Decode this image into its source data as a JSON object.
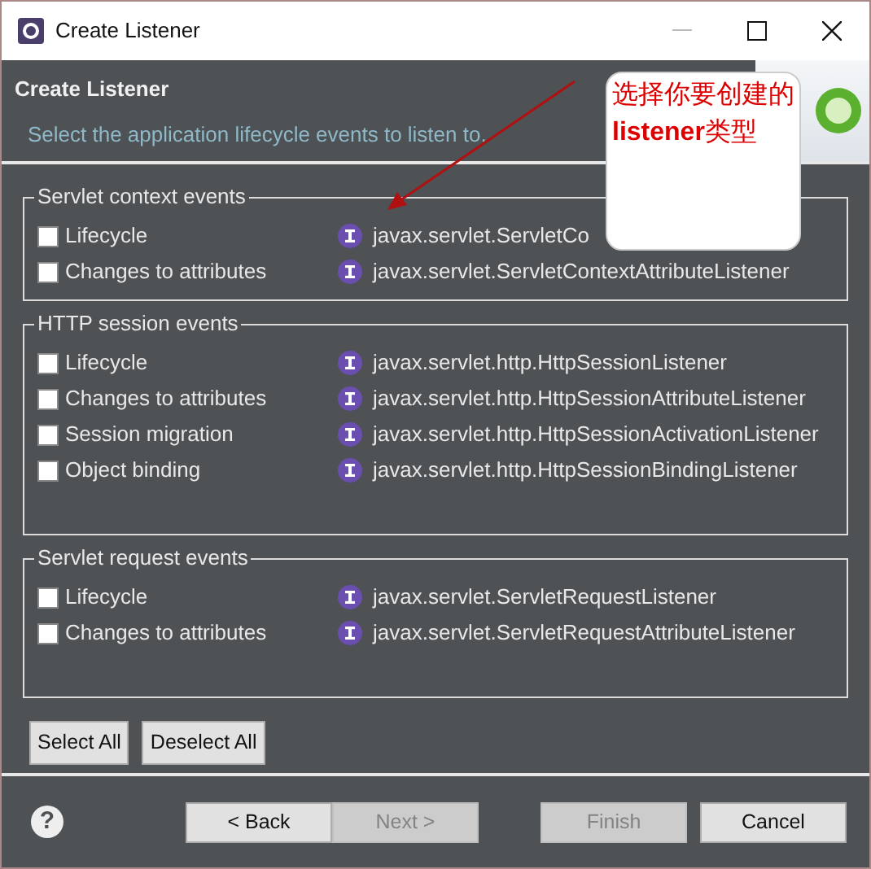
{
  "window": {
    "title": "Create Listener"
  },
  "header": {
    "title": "Create Listener",
    "description": "Select the application lifecycle events to listen to."
  },
  "annotation": {
    "text": "选择你要创建的**listener**类型"
  },
  "groups": [
    {
      "title": "Servlet context events",
      "events": [
        {
          "label": "Lifecycle",
          "interface": "javax.servlet.ServletCo",
          "checked": false
        },
        {
          "label": "Changes to attributes",
          "interface": "javax.servlet.ServletContextAttributeListener",
          "checked": false
        }
      ]
    },
    {
      "title": "HTTP session events",
      "events": [
        {
          "label": "Lifecycle",
          "interface": "javax.servlet.http.HttpSessionListener",
          "checked": false
        },
        {
          "label": "Changes to attributes",
          "interface": "javax.servlet.http.HttpSessionAttributeListener",
          "checked": false
        },
        {
          "label": "Session migration",
          "interface": "javax.servlet.http.HttpSessionActivationListener",
          "checked": false
        },
        {
          "label": "Object binding",
          "interface": "javax.servlet.http.HttpSessionBindingListener",
          "checked": false
        }
      ]
    },
    {
      "title": "Servlet request events",
      "events": [
        {
          "label": "Lifecycle",
          "interface": "javax.servlet.ServletRequestListener",
          "checked": false
        },
        {
          "label": "Changes to attributes",
          "interface": "javax.servlet.ServletRequestAttributeListener",
          "checked": false
        }
      ]
    }
  ],
  "selection_buttons": [
    {
      "label": "Select All"
    },
    {
      "label": "Deselect All"
    }
  ],
  "help": "?",
  "footer_buttons": [
    {
      "label": "< Back",
      "disabled": false
    },
    {
      "label": "Next >",
      "disabled": true
    },
    {
      "label": "Finish",
      "disabled": true
    },
    {
      "label": "Cancel",
      "disabled": false
    }
  ]
}
